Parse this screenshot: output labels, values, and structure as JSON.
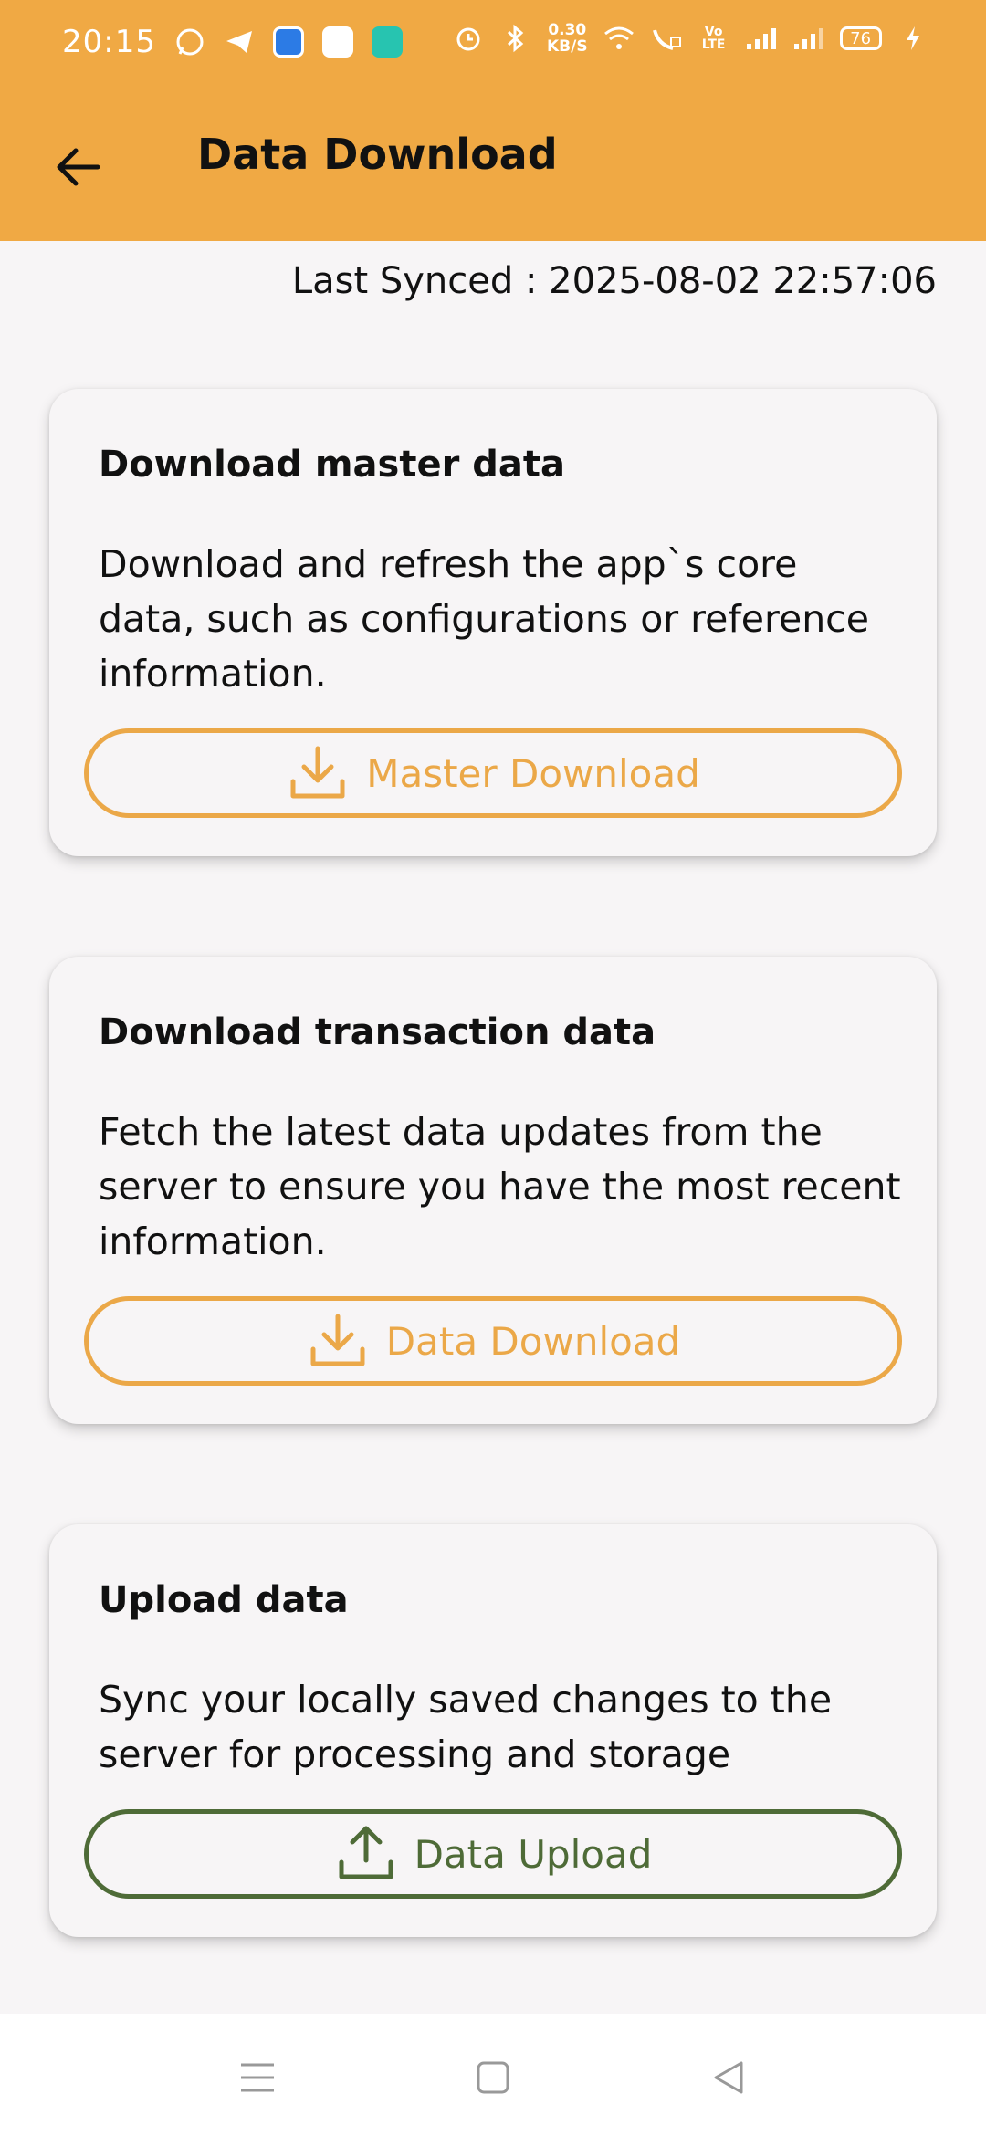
{
  "status_bar": {
    "time": "20:15",
    "speed_value": "0.30",
    "speed_unit": "KB/S",
    "battery": "76",
    "icons": [
      "whatsapp-icon",
      "telegram-icon",
      "app-icon-blue",
      "paytm-icon",
      "app-icon-teal",
      "alarm-icon",
      "bluetooth-icon",
      "wifi-icon",
      "wifi-call-icon",
      "volte-icon",
      "signal-icon",
      "signal-icon",
      "battery-icon",
      "charging-icon"
    ]
  },
  "header": {
    "title": "Data Download",
    "back_icon": "arrow-left-icon"
  },
  "sync": {
    "last_synced": "Last Synced : 2025-08-02 22:57:06"
  },
  "cards": [
    {
      "title": "Download master data",
      "description": "Download and refresh the app`s core data, such as configurations or reference information.",
      "button_label": "Master Download",
      "button_icon": "download-icon",
      "color": "#eba848"
    },
    {
      "title": "Download transaction data",
      "description": "Fetch the latest data updates from the server to ensure you have the most recent information.",
      "button_label": "Data Download",
      "button_icon": "download-icon",
      "color": "#eba848"
    },
    {
      "title": "Upload data",
      "description": "Sync your locally saved changes to the server for processing and storage",
      "button_label": "Data Upload",
      "button_icon": "upload-icon",
      "color": "#4e6b37"
    }
  ],
  "colors": {
    "appbar": "#f0a944",
    "accent": "#eba848",
    "upload": "#4e6b37"
  }
}
